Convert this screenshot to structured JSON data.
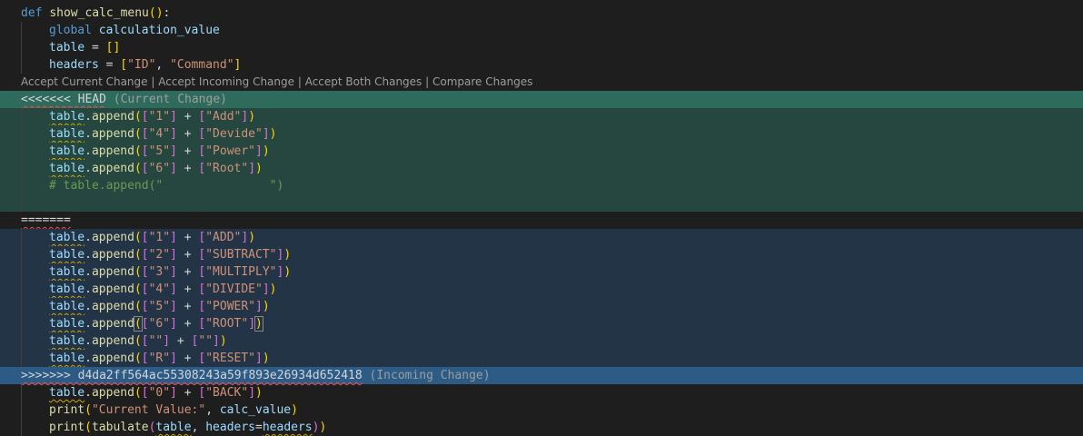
{
  "codelens": {
    "accept_current": "Accept Current Change",
    "accept_incoming": "Accept Incoming Change",
    "accept_both": "Accept Both Changes",
    "compare": "Compare Changes",
    "separator": " | "
  },
  "code": {
    "def_kw": "def",
    "func_name": "show_calc_menu",
    "global_kw": "global",
    "global_var": "calculation_value",
    "table_var": "table",
    "headers_var": "headers",
    "headers_values": [
      "\"ID\"",
      "\"Command\""
    ],
    "append_method": "append",
    "print_fn": "print",
    "tabulate_fn": "tabulate",
    "headers_kw": "headers",
    "calc_value_var": "calc_value",
    "current_value_label": "\"Current Value:\""
  },
  "conflict": {
    "head_marker": "<<<<<<< HEAD",
    "head_label": "(Current Change)",
    "separator_marker": "=======",
    "incoming_marker": ">>>>>>> d4da2ff564ac55308243a59f893e26934d652418",
    "incoming_label": "(Incoming Change)",
    "current_rows": [
      {
        "id": "\"1\"",
        "cmd": "\"Add\""
      },
      {
        "id": "\"4\"",
        "cmd": "\"Devide\""
      },
      {
        "id": "\"5\"",
        "cmd": "\"Power\""
      },
      {
        "id": "\"6\"",
        "cmd": "\"Root\""
      }
    ],
    "current_comment": "# table.append(\"               \")",
    "incoming_rows": [
      {
        "id": "\"1\"",
        "cmd": "\"ADD\""
      },
      {
        "id": "\"2\"",
        "cmd": "\"SUBTRACT\""
      },
      {
        "id": "\"3\"",
        "cmd": "\"MULTIPLY\""
      },
      {
        "id": "\"4\"",
        "cmd": "\"DIVIDE\""
      },
      {
        "id": "\"5\"",
        "cmd": "\"POWER\""
      },
      {
        "id": "\"6\"",
        "cmd": "\"ROOT\""
      },
      {
        "id": "\"\"",
        "cmd": "\"\""
      },
      {
        "id": "\"R\"",
        "cmd": "\"RESET\""
      }
    ],
    "after_row": {
      "id": "\"0\"",
      "cmd": "\"BACK\""
    }
  },
  "colors": {
    "current_bg": "#25473f",
    "current_header_bg": "#2f6b5c",
    "incoming_bg": "#243447",
    "incoming_header_bg": "#2c5b86",
    "editor_bg": "#1e1e1e"
  }
}
